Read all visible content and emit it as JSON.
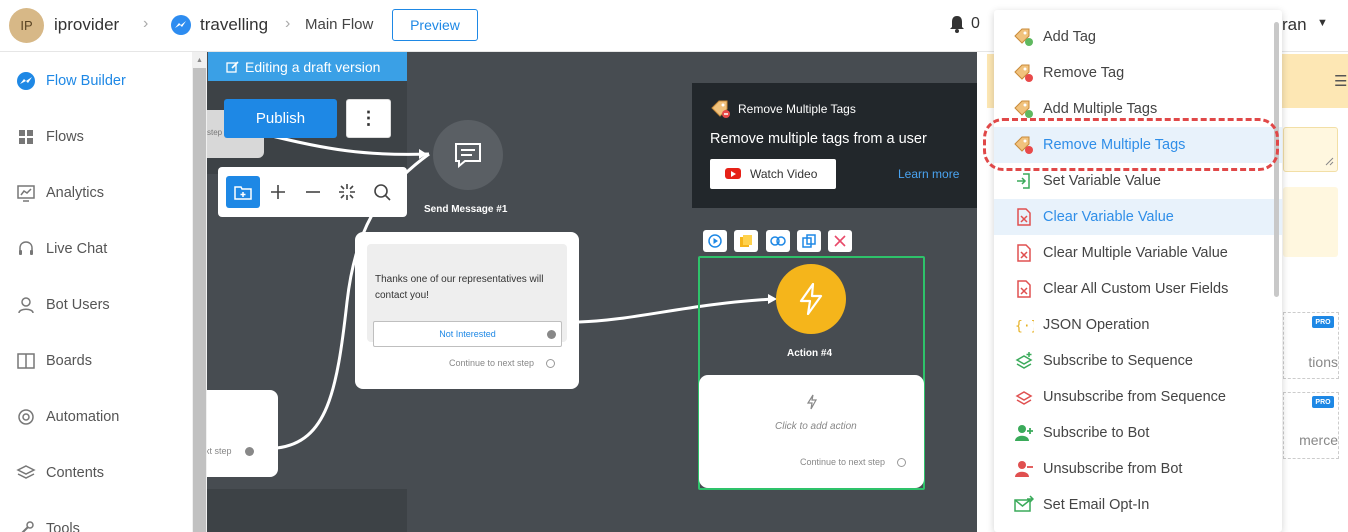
{
  "header": {
    "avatar_initials": "IP",
    "workspace": "iprovider",
    "bot_name": "travelling",
    "flow_name": "Main Flow",
    "preview_label": "Preview",
    "notification_count": "0",
    "user_name_partial": "ran"
  },
  "sidebar": {
    "items": [
      {
        "label": "Flow Builder",
        "icon": "messenger-icon"
      },
      {
        "label": "Flows",
        "icon": "grid-icon"
      },
      {
        "label": "Analytics",
        "icon": "chart-icon"
      },
      {
        "label": "Live Chat",
        "icon": "headset-icon"
      },
      {
        "label": "Bot Users",
        "icon": "user-icon"
      },
      {
        "label": "Boards",
        "icon": "columns-icon"
      },
      {
        "label": "Automation",
        "icon": "gear-icon"
      },
      {
        "label": "Contents",
        "icon": "layers-icon"
      },
      {
        "label": "Tools",
        "icon": "tool-icon"
      }
    ]
  },
  "canvas": {
    "draft_banner": "Editing a draft version",
    "publish_label": "Publish",
    "more_label": "⋮",
    "grey_node_text": "step",
    "send_message_title": "Send Message #1",
    "message_text": "Thanks one of our representatives will contact you!",
    "quick_reply": "Not Interested",
    "continue_next_step": "Continue to next step",
    "left_card_continue": "xt step",
    "action_title": "Action #4",
    "click_to_add_action": "Click to add action",
    "action_continue": "Continue to next step"
  },
  "tooltip": {
    "heading": "Remove Multiple Tags",
    "description": "Remove multiple tags from a user",
    "watch_video": "Watch Video",
    "learn_more": "Learn more"
  },
  "right_panel": {
    "card1_text": "tions",
    "card2_text": "merce",
    "pro_badge": "PRO"
  },
  "dropdown": {
    "items": [
      {
        "label": "Add Tag",
        "icon": "tag-add-icon"
      },
      {
        "label": "Remove Tag",
        "icon": "tag-remove-icon"
      },
      {
        "label": "Add Multiple Tags",
        "icon": "tags-add-icon"
      },
      {
        "label": "Remove Multiple Tags",
        "icon": "tags-remove-icon"
      },
      {
        "label": "Set Variable Value",
        "icon": "variable-set-icon"
      },
      {
        "label": "Clear Variable Value",
        "icon": "variable-clear-icon"
      },
      {
        "label": "Clear Multiple Variable Value",
        "icon": "variable-clear-multi-icon"
      },
      {
        "label": "Clear All Custom User Fields",
        "icon": "fields-clear-icon"
      },
      {
        "label": "JSON Operation",
        "icon": "json-icon"
      },
      {
        "label": "Subscribe to Sequence",
        "icon": "sequence-subscribe-icon"
      },
      {
        "label": "Unsubscribe from Sequence",
        "icon": "sequence-unsubscribe-icon"
      },
      {
        "label": "Subscribe to Bot",
        "icon": "user-add-icon"
      },
      {
        "label": "Unsubscribe from Bot",
        "icon": "user-remove-icon"
      },
      {
        "label": "Set Email Opt-In",
        "icon": "email-optin-icon"
      }
    ]
  },
  "colors": {
    "accent": "#1e88e5",
    "canvas_bg": "#474c51",
    "action_node": "#f5b51b",
    "highlight_ring": "#e04848",
    "selected_frame": "#2ec26a"
  }
}
